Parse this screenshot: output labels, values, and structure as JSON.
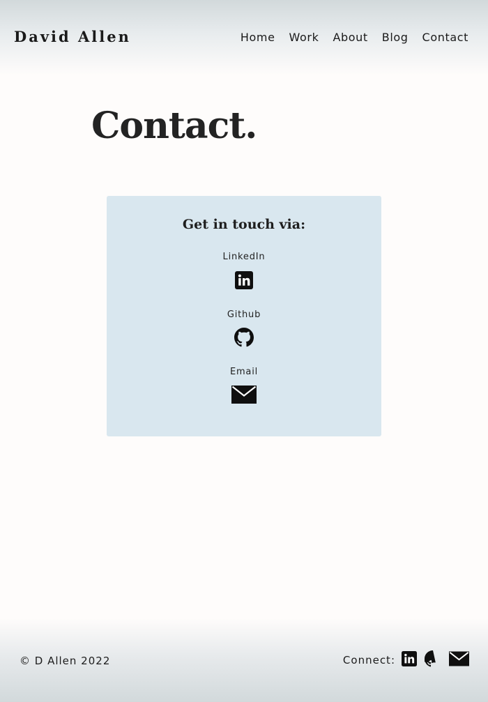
{
  "header": {
    "brand": "David Allen",
    "nav": [
      {
        "label": "Home"
      },
      {
        "label": "Work"
      },
      {
        "label": "About"
      },
      {
        "label": "Blog"
      },
      {
        "label": "Contact"
      }
    ]
  },
  "main": {
    "title": "Contact.",
    "card": {
      "heading": "Get in touch via:",
      "items": [
        {
          "label": "LinkedIn",
          "icon": "linkedin-icon"
        },
        {
          "label": "Github",
          "icon": "github-icon"
        },
        {
          "label": "Email",
          "icon": "mail-icon"
        }
      ],
      "background": "#d9e7ef"
    }
  },
  "footer": {
    "copyright": "© D Allen 2022",
    "connect_label": "Connect:",
    "icons": [
      "linkedin-icon",
      "github-icon",
      "mail-icon"
    ]
  }
}
